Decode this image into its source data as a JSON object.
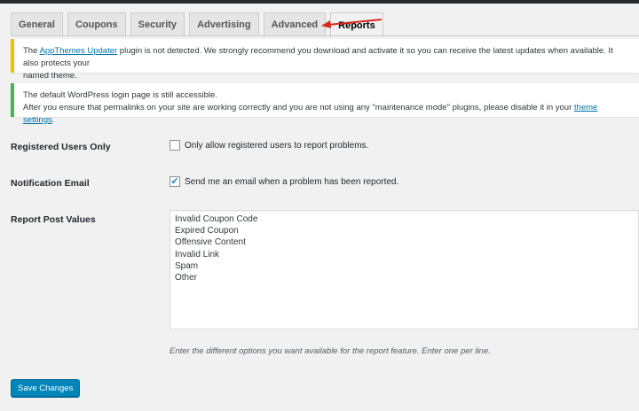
{
  "tabs": [
    {
      "label": "General"
    },
    {
      "label": "Coupons"
    },
    {
      "label": "Security"
    },
    {
      "label": "Advertising"
    },
    {
      "label": "Advanced"
    },
    {
      "label": "Reports"
    }
  ],
  "active_tab": "Reports",
  "notices": {
    "warning": {
      "prefix": "The ",
      "link": "AppThemes Updater",
      "suffix": " plugin is not detected. We strongly recommend you download and activate it so you can receive the latest updates when available. It also protects your",
      "line2": "named theme."
    },
    "login": {
      "line1": "The default WordPress login page is still accessible.",
      "line2_prefix": "After you ensure that permalinks on your site are working correctly and you are not using any \"maintenance mode\" plugins, please disable it in your ",
      "line2_link": "theme settings",
      "line2_suffix": "."
    }
  },
  "settings": {
    "registered_only": {
      "label": "Registered Users Only",
      "checkbox_text": "Only allow registered users to report problems.",
      "checked": false
    },
    "notification_email": {
      "label": "Notification Email",
      "checkbox_text": "Send me an email when a problem has been reported.",
      "checked": true
    },
    "report_values": {
      "label": "Report Post Values",
      "lines": [
        "Invalid Coupon Code",
        "Expired Coupon",
        "Offensive Content",
        "Invalid Link",
        "Spam",
        "Other"
      ],
      "description": "Enter the different options you want available for the report feature. Enter one per line."
    }
  },
  "save_label": "Save Changes",
  "colors": {
    "accent": "#0085ba",
    "warning": "#ffb900",
    "success": "#46b450",
    "annotation_arrow": "#d9261c"
  }
}
